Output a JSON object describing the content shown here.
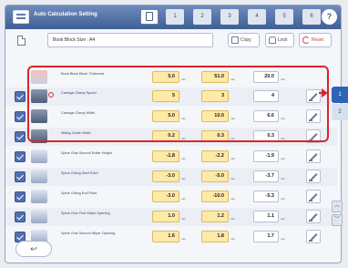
{
  "window": {
    "title": "Auto Calculation Setting"
  },
  "page_tabs": [
    "1",
    "2",
    "3",
    "4",
    "5",
    "6"
  ],
  "help_label": "?",
  "header": {
    "setting_name": "Book Block Size : A4",
    "copy_label": "Copy",
    "lock_label": "Lock",
    "reset_label": "Reset"
  },
  "rows": [
    {
      "label": "Book Block Block Thickness",
      "checked": false,
      "v1": "5.0",
      "u1": "mm",
      "v2": "51.0",
      "u2": "mm",
      "v3": "20.0",
      "u3": "mm",
      "icon": "book-icon"
    },
    {
      "label": "Carriage Clamp Speed",
      "checked": true,
      "v1": "5",
      "u1": "",
      "v2": "3",
      "u2": "",
      "v3": "4",
      "u3": "",
      "icon": "carriage-clamp-icon"
    },
    {
      "label": "Carriage Clamp Width",
      "checked": true,
      "v1": "5.0",
      "u1": "mm",
      "v2": "10.0",
      "u2": "mm",
      "v3": "6.6",
      "u3": "mm",
      "icon": "carriage-clamp-width-icon"
    },
    {
      "label": "Milling Guide Width",
      "checked": true,
      "v1": "0.2",
      "u1": "mm",
      "v2": "0.3",
      "u2": "mm",
      "v3": "0.3",
      "u3": "mm",
      "icon": "milling-guide-icon"
    },
    {
      "label": "Spine Glue Second Roller Height",
      "checked": true,
      "v1": "-1.8",
      "u1": "mm",
      "v2": "-2.2",
      "u2": "mm",
      "v3": "-1.9",
      "u3": "mm",
      "icon": "glue-roller-icon"
    },
    {
      "label": "Spine Gluing Start Point",
      "checked": true,
      "v1": "-3.0",
      "u1": "mm",
      "v2": "-5.0",
      "u2": "mm",
      "v3": "-3.7",
      "u3": "mm",
      "icon": "gluing-start-icon"
    },
    {
      "label": "Spine Gluing End Point",
      "checked": true,
      "v1": "-3.0",
      "u1": "mm",
      "v2": "-10.0",
      "u2": "mm",
      "v3": "-5.3",
      "u3": "mm",
      "icon": "gluing-end-icon"
    },
    {
      "label": "Spine Glue First Wiper Opening",
      "checked": true,
      "v1": "1.0",
      "u1": "mm",
      "v2": "1.2",
      "u2": "mm",
      "v3": "1.1",
      "u3": "mm",
      "icon": "first-wiper-icon"
    },
    {
      "label": "Spine Glue Second Wiper Opening",
      "checked": true,
      "v1": "1.6",
      "u1": "mm",
      "v2": "1.8",
      "u2": "mm",
      "v3": "1.7",
      "u3": "mm",
      "icon": "second-wiper-icon"
    }
  ],
  "side_tabs": [
    "1",
    "2"
  ],
  "scroll_up_glyph": "︿",
  "scroll_down_glyph": "﹀",
  "back_glyph": "↩",
  "colors": {
    "accent": "#2f63b8",
    "highlight": "#d9262b",
    "input_highlight": "#ffe9a6"
  }
}
